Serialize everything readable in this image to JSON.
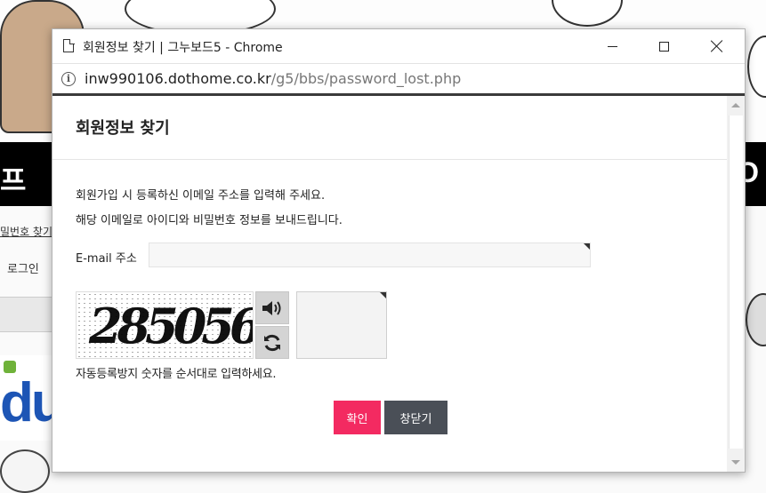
{
  "window": {
    "title": "회원정보 찾기 | 그누보드5 - Chrome",
    "url_host": "inw990106.dothome.co.kr",
    "url_path": "/g5/bbs/password_lost.php"
  },
  "dialog": {
    "title": "회원정보 찾기",
    "description_line1": "회원가입 시 등록하신 이메일 주소를 입력해 주세요.",
    "description_line2": "해당 이메일로 아이디와 비밀번호 정보를 보내드립니다.",
    "email_label": "E-mail 주소",
    "email_value": "",
    "captcha": {
      "image_text": "285056",
      "help_text": "자동등록방지 숫자를 순서대로 입력하세요.",
      "input_value": "",
      "audio_icon": "speaker-icon",
      "refresh_icon": "refresh-icon"
    },
    "buttons": {
      "confirm": "확인",
      "close": "창닫기"
    }
  },
  "background_page": {
    "band_left_text": "프",
    "band_right_text": "O",
    "link_text": "밀번호 찾기",
    "login_text": "로그인",
    "logo_text": "du"
  },
  "colors": {
    "confirm_button": "#f32a61",
    "close_button": "#4a4f57",
    "loading_bar": "#3a3a3a"
  }
}
